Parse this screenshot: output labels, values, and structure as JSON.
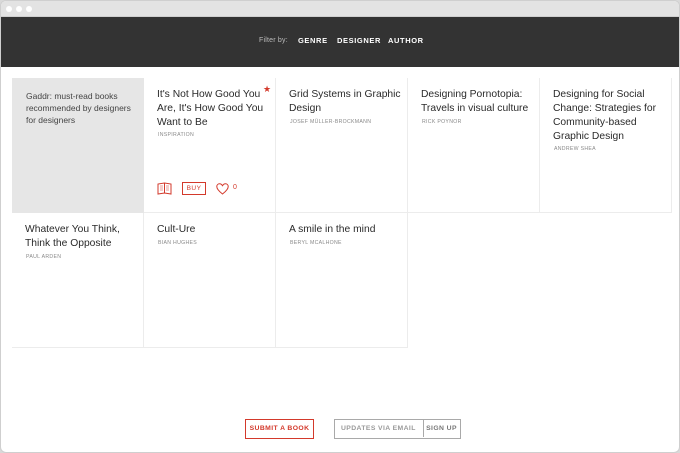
{
  "filter": {
    "label": "Filter by:",
    "options": [
      "GENRE",
      "DESIGNER",
      "AUTHOR"
    ]
  },
  "intro": "Gaddr: must-read books recommended by designers for designers",
  "books": [
    {
      "title": "It's Not How Good You Are, It's How Good You Want to Be",
      "author": "INSPIRATION",
      "starred": true,
      "buy_label": "BUY",
      "likes": "0"
    },
    {
      "title": "Grid Systems in Graphic Design",
      "author": "JOSEF MÜLLER-BROCKMANN"
    },
    {
      "title": "Designing Pornotopia: Travels in visual culture",
      "author": "RICK POYNOR"
    },
    {
      "title": "Designing for Social Change: Strategies for Community-based Graphic Design",
      "author": "ANDREW SHEA"
    },
    {
      "title": "Whatever You Think, Think the Opposite",
      "author": "PAUL ARDEN"
    },
    {
      "title": "Cult-Ure",
      "author": "BIAN HUGHES"
    },
    {
      "title": "A smile in the mind",
      "author": "BERYL MCALHONE"
    }
  ],
  "footer": {
    "submit_label": "SUBMIT A BOOK",
    "email_placeholder": "UPDATES VIA EMAIL",
    "signup_label": "SIGN UP"
  },
  "colors": {
    "accent": "#d3392b",
    "filterbar": "#333333",
    "intro_bg": "#e6e6e6"
  }
}
